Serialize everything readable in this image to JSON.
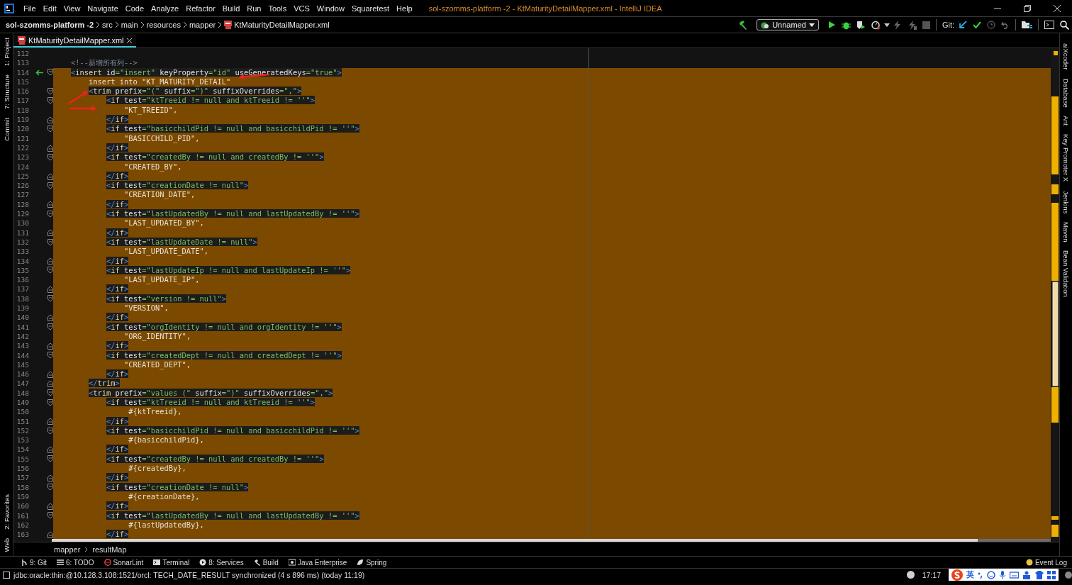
{
  "window": {
    "title": "sol-szomms-platform -2 - KtMaturityDetailMapper.xml - IntelliJ IDEA"
  },
  "menu": [
    "File",
    "Edit",
    "View",
    "Navigate",
    "Code",
    "Analyze",
    "Refactor",
    "Build",
    "Run",
    "Tools",
    "VCS",
    "Window",
    "Squaretest",
    "Help"
  ],
  "navigation": [
    {
      "text": "sol-szomms-platform -2",
      "kind": "project"
    },
    {
      "text": "src",
      "kind": "folder"
    },
    {
      "text": "main",
      "kind": "folder"
    },
    {
      "text": "resources",
      "kind": "folder"
    },
    {
      "text": "mapper",
      "kind": "folder"
    },
    {
      "text": "KtMaturityDetailMapper.xml",
      "kind": "file"
    }
  ],
  "run_configuration": {
    "name": "Unnamed"
  },
  "vcs": {
    "label": "Git:"
  },
  "tabs": [
    {
      "label": "KtMaturityDetailMapper.xml",
      "selected": true
    }
  ],
  "left_tool_windows": {
    "top": [
      "1: Project",
      "7: Structure",
      "Commit"
    ],
    "bottom": [
      "2: Favorites",
      "Web"
    ]
  },
  "right_tool_windows": [
    "aiXcoder",
    "Database",
    "Ant",
    "Key Promoter X",
    "Jenkins",
    "Maven",
    "Bean Validation"
  ],
  "editor": {
    "lines": [
      {
        "number": "112",
        "selected": false,
        "kind": "text"
      },
      {
        "number": "113",
        "selected": false,
        "kind": "text",
        "tokens": [
          {
            "kind": "comment",
            "text": "    <!--新增所有列-->"
          }
        ]
      },
      {
        "number": "114",
        "selected": true,
        "kind": "tag_open",
        "marked": true,
        "tokens": [
          {
            "kind": "bracket",
            "text": "    <"
          },
          {
            "kind": "tag",
            "text": "insert"
          },
          {
            "kind": "attr",
            "text": " id"
          },
          {
            "kind": "value",
            "text": "=\"insert\""
          },
          {
            "kind": "attr",
            "text": " keyProperty"
          },
          {
            "kind": "value",
            "text": "=\"id\""
          },
          {
            "kind": "attr",
            "text": " useGeneratedKeys"
          },
          {
            "kind": "value",
            "text": "=\"true\""
          },
          {
            "kind": "bracket",
            "text": ">"
          }
        ]
      },
      {
        "number": "115",
        "selected": true,
        "kind": "text",
        "tokens": [
          {
            "kind": "plain",
            "text": "        insert into \"KT_MATURITY_DETAIL\""
          }
        ]
      },
      {
        "number": "116",
        "selected": true,
        "kind": "tag_open",
        "tokens": [
          {
            "kind": "bracket",
            "text": "        <"
          },
          {
            "kind": "tag",
            "text": "trim"
          },
          {
            "kind": "attr",
            "text": " prefix"
          },
          {
            "kind": "value",
            "text": "=\"(\""
          },
          {
            "kind": "attr",
            "text": " suffix"
          },
          {
            "kind": "value",
            "text": "=\")\""
          },
          {
            "kind": "attr",
            "text": " suffixOverrides"
          },
          {
            "kind": "value",
            "text": "=\",\""
          },
          {
            "kind": "bracket",
            "text": ">"
          }
        ]
      },
      {
        "number": "117",
        "selected": true,
        "kind": "tag_open",
        "tokens": [
          {
            "kind": "bracket",
            "text": "            <"
          },
          {
            "kind": "tag",
            "text": "if"
          },
          {
            "kind": "attr",
            "text": " test"
          },
          {
            "kind": "value",
            "text": "=\"ktTreeid != null and ktTreeid != ''\""
          },
          {
            "kind": "bracket",
            "text": ">"
          }
        ]
      },
      {
        "number": "118",
        "selected": true,
        "kind": "text",
        "tokens": [
          {
            "kind": "plain",
            "text": "                \"KT_TREEID\","
          }
        ]
      },
      {
        "number": "119",
        "selected": true,
        "kind": "tag_close",
        "tokens": [
          {
            "kind": "bracket",
            "text": "            </"
          },
          {
            "kind": "tag",
            "text": "if"
          },
          {
            "kind": "bracket",
            "text": ">"
          }
        ]
      },
      {
        "number": "120",
        "selected": true,
        "kind": "tag_open",
        "tokens": [
          {
            "kind": "bracket",
            "text": "            <"
          },
          {
            "kind": "tag",
            "text": "if"
          },
          {
            "kind": "attr",
            "text": " test"
          },
          {
            "kind": "value",
            "text": "=\"basicchildPid != null and basicchildPid != ''\""
          },
          {
            "kind": "bracket",
            "text": ">"
          }
        ]
      },
      {
        "number": "121",
        "selected": true,
        "kind": "text",
        "tokens": [
          {
            "kind": "plain",
            "text": "                \"BASICCHILD_PID\","
          }
        ]
      },
      {
        "number": "122",
        "selected": true,
        "kind": "tag_close",
        "tokens": [
          {
            "kind": "bracket",
            "text": "            </"
          },
          {
            "kind": "tag",
            "text": "if"
          },
          {
            "kind": "bracket",
            "text": ">"
          }
        ]
      },
      {
        "number": "123",
        "selected": true,
        "kind": "tag_open",
        "tokens": [
          {
            "kind": "bracket",
            "text": "            <"
          },
          {
            "kind": "tag",
            "text": "if"
          },
          {
            "kind": "attr",
            "text": " test"
          },
          {
            "kind": "value",
            "text": "=\"createdBy != null and createdBy != ''\""
          },
          {
            "kind": "bracket",
            "text": ">"
          }
        ]
      },
      {
        "number": "124",
        "selected": true,
        "kind": "text",
        "tokens": [
          {
            "kind": "plain",
            "text": "                \"CREATED_BY\","
          }
        ]
      },
      {
        "number": "125",
        "selected": true,
        "kind": "tag_close",
        "tokens": [
          {
            "kind": "bracket",
            "text": "            </"
          },
          {
            "kind": "tag",
            "text": "if"
          },
          {
            "kind": "bracket",
            "text": ">"
          }
        ]
      },
      {
        "number": "126",
        "selected": true,
        "kind": "tag_open",
        "tokens": [
          {
            "kind": "bracket",
            "text": "            <"
          },
          {
            "kind": "tag",
            "text": "if"
          },
          {
            "kind": "attr",
            "text": " test"
          },
          {
            "kind": "value",
            "text": "=\"creationDate != null\""
          },
          {
            "kind": "bracket",
            "text": ">"
          }
        ]
      },
      {
        "number": "127",
        "selected": true,
        "kind": "text",
        "tokens": [
          {
            "kind": "plain",
            "text": "                \"CREATION_DATE\","
          }
        ]
      },
      {
        "number": "128",
        "selected": true,
        "kind": "tag_close",
        "tokens": [
          {
            "kind": "bracket",
            "text": "            </"
          },
          {
            "kind": "tag",
            "text": "if"
          },
          {
            "kind": "bracket",
            "text": ">"
          }
        ]
      },
      {
        "number": "129",
        "selected": true,
        "kind": "tag_open",
        "tokens": [
          {
            "kind": "bracket",
            "text": "            <"
          },
          {
            "kind": "tag",
            "text": "if"
          },
          {
            "kind": "attr",
            "text": " test"
          },
          {
            "kind": "value",
            "text": "=\"lastUpdatedBy != null and lastUpdatedBy != ''\""
          },
          {
            "kind": "bracket",
            "text": ">"
          }
        ]
      },
      {
        "number": "130",
        "selected": true,
        "kind": "text",
        "tokens": [
          {
            "kind": "plain",
            "text": "                \"LAST_UPDATED_BY\","
          }
        ]
      },
      {
        "number": "131",
        "selected": true,
        "kind": "tag_close",
        "tokens": [
          {
            "kind": "bracket",
            "text": "            </"
          },
          {
            "kind": "tag",
            "text": "if"
          },
          {
            "kind": "bracket",
            "text": ">"
          }
        ]
      },
      {
        "number": "132",
        "selected": true,
        "kind": "tag_open",
        "tokens": [
          {
            "kind": "bracket",
            "text": "            <"
          },
          {
            "kind": "tag",
            "text": "if"
          },
          {
            "kind": "attr",
            "text": " test"
          },
          {
            "kind": "value",
            "text": "=\"lastUpdateDate != null\""
          },
          {
            "kind": "bracket",
            "text": ">"
          }
        ]
      },
      {
        "number": "133",
        "selected": true,
        "kind": "text",
        "tokens": [
          {
            "kind": "plain",
            "text": "                \"LAST_UPDATE_DATE\","
          }
        ]
      },
      {
        "number": "134",
        "selected": true,
        "kind": "tag_close",
        "tokens": [
          {
            "kind": "bracket",
            "text": "            </"
          },
          {
            "kind": "tag",
            "text": "if"
          },
          {
            "kind": "bracket",
            "text": ">"
          }
        ]
      },
      {
        "number": "135",
        "selected": true,
        "kind": "tag_open",
        "tokens": [
          {
            "kind": "bracket",
            "text": "            <"
          },
          {
            "kind": "tag",
            "text": "if"
          },
          {
            "kind": "attr",
            "text": " test"
          },
          {
            "kind": "value",
            "text": "=\"lastUpdateIp != null and lastUpdateIp != ''\""
          },
          {
            "kind": "bracket",
            "text": ">"
          }
        ]
      },
      {
        "number": "136",
        "selected": true,
        "kind": "text",
        "tokens": [
          {
            "kind": "plain",
            "text": "                \"LAST_UPDATE_IP\","
          }
        ]
      },
      {
        "number": "137",
        "selected": true,
        "kind": "tag_close",
        "tokens": [
          {
            "kind": "bracket",
            "text": "            </"
          },
          {
            "kind": "tag",
            "text": "if"
          },
          {
            "kind": "bracket",
            "text": ">"
          }
        ]
      },
      {
        "number": "138",
        "selected": true,
        "kind": "tag_open",
        "tokens": [
          {
            "kind": "bracket",
            "text": "            <"
          },
          {
            "kind": "tag",
            "text": "if"
          },
          {
            "kind": "attr",
            "text": " test"
          },
          {
            "kind": "value",
            "text": "=\"version != null\""
          },
          {
            "kind": "bracket",
            "text": ">"
          }
        ]
      },
      {
        "number": "139",
        "selected": true,
        "kind": "text",
        "tokens": [
          {
            "kind": "plain",
            "text": "                \"VERSION\","
          }
        ]
      },
      {
        "number": "140",
        "selected": true,
        "kind": "tag_close",
        "tokens": [
          {
            "kind": "bracket",
            "text": "            </"
          },
          {
            "kind": "tag",
            "text": "if"
          },
          {
            "kind": "bracket",
            "text": ">"
          }
        ]
      },
      {
        "number": "141",
        "selected": true,
        "kind": "tag_open",
        "tokens": [
          {
            "kind": "bracket",
            "text": "            <"
          },
          {
            "kind": "tag",
            "text": "if"
          },
          {
            "kind": "attr",
            "text": " test"
          },
          {
            "kind": "value",
            "text": "=\"orgIdentity != null and orgIdentity != ''\""
          },
          {
            "kind": "bracket",
            "text": ">"
          }
        ]
      },
      {
        "number": "142",
        "selected": true,
        "kind": "text",
        "tokens": [
          {
            "kind": "plain",
            "text": "                \"ORG_IDENTITY\","
          }
        ]
      },
      {
        "number": "143",
        "selected": true,
        "kind": "tag_close",
        "tokens": [
          {
            "kind": "bracket",
            "text": "            </"
          },
          {
            "kind": "tag",
            "text": "if"
          },
          {
            "kind": "bracket",
            "text": ">"
          }
        ]
      },
      {
        "number": "144",
        "selected": true,
        "kind": "tag_open",
        "tokens": [
          {
            "kind": "bracket",
            "text": "            <"
          },
          {
            "kind": "tag",
            "text": "if"
          },
          {
            "kind": "attr",
            "text": " test"
          },
          {
            "kind": "value",
            "text": "=\"createdDept != null and createdDept != ''\""
          },
          {
            "kind": "bracket",
            "text": ">"
          }
        ]
      },
      {
        "number": "145",
        "selected": true,
        "kind": "text",
        "tokens": [
          {
            "kind": "plain",
            "text": "                \"CREATED_DEPT\","
          }
        ]
      },
      {
        "number": "146",
        "selected": true,
        "kind": "tag_close",
        "tokens": [
          {
            "kind": "bracket",
            "text": "            </"
          },
          {
            "kind": "tag",
            "text": "if"
          },
          {
            "kind": "bracket",
            "text": ">"
          }
        ]
      },
      {
        "number": "147",
        "selected": true,
        "kind": "tag_close",
        "tokens": [
          {
            "kind": "bracket",
            "text": "        </"
          },
          {
            "kind": "tag",
            "text": "trim"
          },
          {
            "kind": "bracket",
            "text": ">"
          }
        ]
      },
      {
        "number": "148",
        "selected": true,
        "kind": "tag_open",
        "tokens": [
          {
            "kind": "bracket",
            "text": "        <"
          },
          {
            "kind": "tag",
            "text": "trim"
          },
          {
            "kind": "attr",
            "text": " prefix"
          },
          {
            "kind": "value",
            "text": "=\"values (\""
          },
          {
            "kind": "attr",
            "text": " suffix"
          },
          {
            "kind": "value",
            "text": "=\")\""
          },
          {
            "kind": "attr",
            "text": " suffixOverrides"
          },
          {
            "kind": "value",
            "text": "=\",\""
          },
          {
            "kind": "bracket",
            "text": ">"
          }
        ]
      },
      {
        "number": "149",
        "selected": true,
        "kind": "tag_open",
        "tokens": [
          {
            "kind": "bracket",
            "text": "            <"
          },
          {
            "kind": "tag",
            "text": "if"
          },
          {
            "kind": "attr",
            "text": " test"
          },
          {
            "kind": "value",
            "text": "=\"ktTreeid != null and ktTreeid != ''\""
          },
          {
            "kind": "bracket",
            "text": ">"
          }
        ]
      },
      {
        "number": "150",
        "selected": true,
        "kind": "text",
        "tokens": [
          {
            "kind": "plain",
            "text": "                 #{ktTreeid},"
          }
        ]
      },
      {
        "number": "151",
        "selected": true,
        "kind": "tag_close",
        "tokens": [
          {
            "kind": "bracket",
            "text": "            </"
          },
          {
            "kind": "tag",
            "text": "if"
          },
          {
            "kind": "bracket",
            "text": ">"
          }
        ]
      },
      {
        "number": "152",
        "selected": true,
        "kind": "tag_open",
        "tokens": [
          {
            "kind": "bracket",
            "text": "            <"
          },
          {
            "kind": "tag",
            "text": "if"
          },
          {
            "kind": "attr",
            "text": " test"
          },
          {
            "kind": "value",
            "text": "=\"basicchildPid != null and basicchildPid != ''\""
          },
          {
            "kind": "bracket",
            "text": ">"
          }
        ]
      },
      {
        "number": "153",
        "selected": true,
        "kind": "text",
        "tokens": [
          {
            "kind": "plain",
            "text": "                 #{basicchildPid},"
          }
        ]
      },
      {
        "number": "154",
        "selected": true,
        "kind": "tag_close",
        "tokens": [
          {
            "kind": "bracket",
            "text": "            </"
          },
          {
            "kind": "tag",
            "text": "if"
          },
          {
            "kind": "bracket",
            "text": ">"
          }
        ]
      },
      {
        "number": "155",
        "selected": true,
        "kind": "tag_open",
        "tokens": [
          {
            "kind": "bracket",
            "text": "            <"
          },
          {
            "kind": "tag",
            "text": "if"
          },
          {
            "kind": "attr",
            "text": " test"
          },
          {
            "kind": "value",
            "text": "=\"createdBy != null and createdBy != ''\""
          },
          {
            "kind": "bracket",
            "text": ">"
          }
        ]
      },
      {
        "number": "156",
        "selected": true,
        "kind": "text",
        "tokens": [
          {
            "kind": "plain",
            "text": "                 #{createdBy},"
          }
        ]
      },
      {
        "number": "157",
        "selected": true,
        "kind": "tag_close",
        "tokens": [
          {
            "kind": "bracket",
            "text": "            </"
          },
          {
            "kind": "tag",
            "text": "if"
          },
          {
            "kind": "bracket",
            "text": ">"
          }
        ]
      },
      {
        "number": "158",
        "selected": true,
        "kind": "tag_open",
        "tokens": [
          {
            "kind": "bracket",
            "text": "            <"
          },
          {
            "kind": "tag",
            "text": "if"
          },
          {
            "kind": "attr",
            "text": " test"
          },
          {
            "kind": "value",
            "text": "=\"creationDate != null\""
          },
          {
            "kind": "bracket",
            "text": ">"
          }
        ]
      },
      {
        "number": "159",
        "selected": true,
        "kind": "text",
        "tokens": [
          {
            "kind": "plain",
            "text": "                 #{creationDate},"
          }
        ]
      },
      {
        "number": "160",
        "selected": true,
        "kind": "tag_close",
        "tokens": [
          {
            "kind": "bracket",
            "text": "            </"
          },
          {
            "kind": "tag",
            "text": "if"
          },
          {
            "kind": "bracket",
            "text": ">"
          }
        ]
      },
      {
        "number": "161",
        "selected": true,
        "kind": "tag_open",
        "tokens": [
          {
            "kind": "bracket",
            "text": "            <"
          },
          {
            "kind": "tag",
            "text": "if"
          },
          {
            "kind": "attr",
            "text": " test"
          },
          {
            "kind": "value",
            "text": "=\"lastUpdatedBy != null and lastUpdatedBy != ''\""
          },
          {
            "kind": "bracket",
            "text": ">"
          }
        ]
      },
      {
        "number": "162",
        "selected": true,
        "kind": "text",
        "tokens": [
          {
            "kind": "plain",
            "text": "                 #{lastUpdatedBy},"
          }
        ]
      },
      {
        "number": "163",
        "selected": true,
        "kind": "tag_close",
        "tokens": [
          {
            "kind": "bracket",
            "text": "            </"
          },
          {
            "kind": "tag",
            "text": "if"
          },
          {
            "kind": "bracket",
            "text": ">"
          }
        ]
      }
    ]
  },
  "breadcrumb": [
    "mapper",
    "resultMap"
  ],
  "tool_windows": [
    {
      "label": "9: Git",
      "kind": "git"
    },
    {
      "label": "6: TODO",
      "kind": "todo"
    },
    {
      "label": "SonarLint",
      "kind": "sonar"
    },
    {
      "label": "Terminal",
      "kind": "terminal"
    },
    {
      "label": "8: Services",
      "kind": "services"
    },
    {
      "label": "Build",
      "kind": "build"
    },
    {
      "label": "Java Enterprise",
      "kind": "enterprise"
    },
    {
      "label": "Spring",
      "kind": "spring"
    }
  ],
  "event_log": {
    "label": "Event Log"
  },
  "status_bar": {
    "message": "jdbc:oracle:thin:@10.128.3.108:1521/orcl: TECH_DATE_RESULT synchronized (4 s 896 ms) (today 11:19)",
    "clock": "17:17",
    "input_language": "英"
  }
}
